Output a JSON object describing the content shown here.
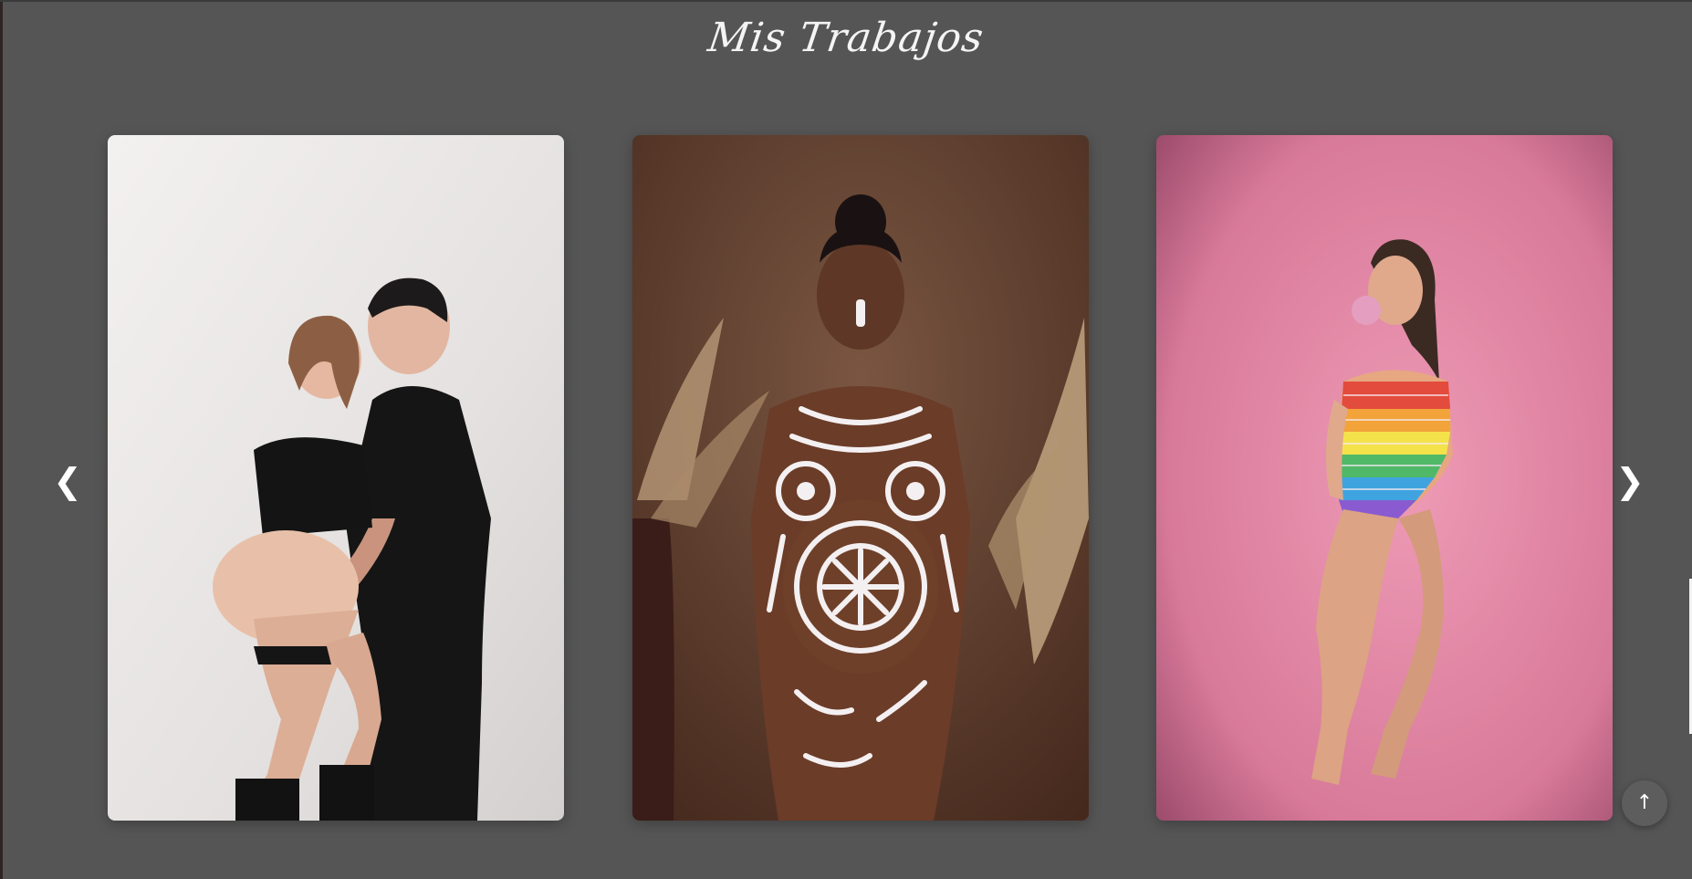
{
  "section": {
    "title": "Mis Trabajos"
  },
  "gallery": {
    "prev_label": "❮",
    "next_label": "❯",
    "photos": [
      {
        "alt": "",
        "icon": "photo-couple-maternity"
      },
      {
        "alt": "",
        "icon": "photo-body-paint-maternity"
      },
      {
        "alt": "",
        "icon": "photo-pink-maternity"
      }
    ]
  },
  "scroll_top": {
    "label": "↑"
  },
  "colors": {
    "background": "#555555",
    "title": "#f4f4f4",
    "arrow": "#ffffff"
  }
}
